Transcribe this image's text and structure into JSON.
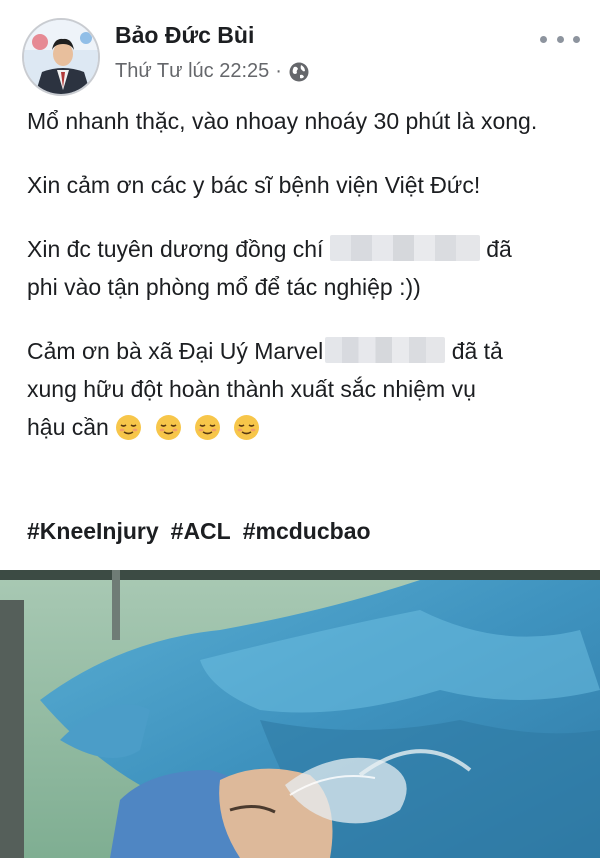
{
  "post": {
    "author": "Bảo Đức Bùi",
    "timestamp": "Thứ Tư lúc 22:25",
    "separator": "·",
    "privacy_icon": "globe-icon",
    "more_icon": "more-options-icon",
    "paragraphs": {
      "p1": "Mổ nhanh thặc, vào nhoay nhoáy 30 phút là xong.",
      "p2": "Xin cảm ơn các y bác sĩ bệnh viện Việt Đức!",
      "p3_before": "Xin đc tuyên dương đồng chí ",
      "p3_after_line1": "đã",
      "p3_line2": "phi vào tận phòng mổ để tác nghiệp :))",
      "p4_before": "Cảm ơn bà xã Đại Uý Marvel",
      "p4_after": "đã tả",
      "p4_line2": "xung hữu đột hoàn thành xuất sắc nhiệm vụ",
      "p4_line3": "hậu cần"
    },
    "emoji": "relieved-face-icon",
    "emoji_count": 4,
    "hashtags": [
      "#KneeInjury",
      "#ACL",
      "#mcducbao"
    ]
  },
  "colors": {
    "text": "#1c1e21",
    "meta": "#65676b",
    "drape": "#4aa0c8"
  }
}
